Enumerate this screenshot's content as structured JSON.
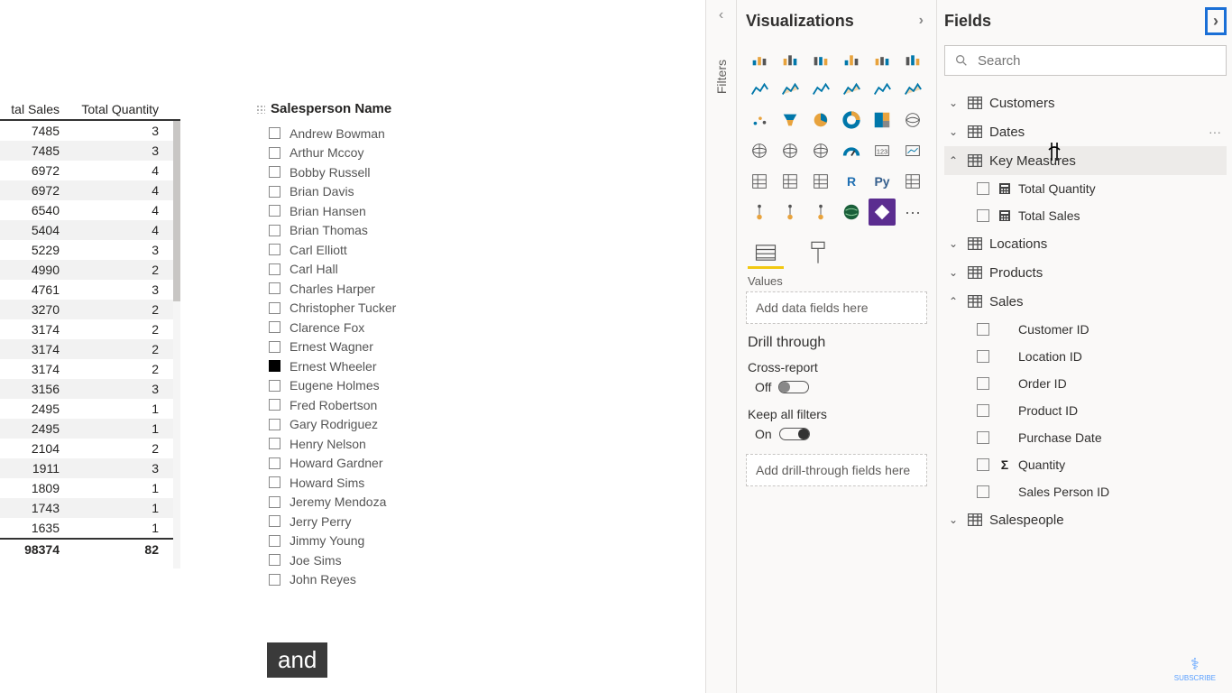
{
  "panes": {
    "visualizations_title": "Visualizations",
    "fields_title": "Fields",
    "filters_title": "Filters"
  },
  "search": {
    "placeholder": "Search"
  },
  "table": {
    "headers": {
      "sales": "tal Sales",
      "qty": "Total Quantity"
    },
    "rows": [
      {
        "sales": "7485",
        "qty": "3"
      },
      {
        "sales": "7485",
        "qty": "3"
      },
      {
        "sales": "6972",
        "qty": "4"
      },
      {
        "sales": "6972",
        "qty": "4"
      },
      {
        "sales": "6540",
        "qty": "4"
      },
      {
        "sales": "5404",
        "qty": "4"
      },
      {
        "sales": "5229",
        "qty": "3"
      },
      {
        "sales": "4990",
        "qty": "2"
      },
      {
        "sales": "4761",
        "qty": "3"
      },
      {
        "sales": "3270",
        "qty": "2"
      },
      {
        "sales": "3174",
        "qty": "2"
      },
      {
        "sales": "3174",
        "qty": "2"
      },
      {
        "sales": "3174",
        "qty": "2"
      },
      {
        "sales": "3156",
        "qty": "3"
      },
      {
        "sales": "2495",
        "qty": "1"
      },
      {
        "sales": "2495",
        "qty": "1"
      },
      {
        "sales": "2104",
        "qty": "2"
      },
      {
        "sales": "1911",
        "qty": "3"
      },
      {
        "sales": "1809",
        "qty": "1"
      },
      {
        "sales": "1743",
        "qty": "1"
      },
      {
        "sales": "1635",
        "qty": "1"
      }
    ],
    "total": {
      "sales": "98374",
      "qty": "82"
    }
  },
  "slicer": {
    "title": "Salesperson Name",
    "items": [
      {
        "name": "Andrew Bowman",
        "checked": false
      },
      {
        "name": "Arthur Mccoy",
        "checked": false
      },
      {
        "name": "Bobby Russell",
        "checked": false
      },
      {
        "name": "Brian Davis",
        "checked": false
      },
      {
        "name": "Brian Hansen",
        "checked": false
      },
      {
        "name": "Brian Thomas",
        "checked": false
      },
      {
        "name": "Carl Elliott",
        "checked": false
      },
      {
        "name": "Carl Hall",
        "checked": false
      },
      {
        "name": "Charles Harper",
        "checked": false
      },
      {
        "name": "Christopher Tucker",
        "checked": false
      },
      {
        "name": "Clarence Fox",
        "checked": false
      },
      {
        "name": "Ernest Wagner",
        "checked": false
      },
      {
        "name": "Ernest Wheeler",
        "checked": true
      },
      {
        "name": "Eugene Holmes",
        "checked": false
      },
      {
        "name": "Fred Robertson",
        "checked": false
      },
      {
        "name": "Gary Rodriguez",
        "checked": false
      },
      {
        "name": "Henry Nelson",
        "checked": false
      },
      {
        "name": "Howard Gardner",
        "checked": false
      },
      {
        "name": "Howard Sims",
        "checked": false
      },
      {
        "name": "Jeremy Mendoza",
        "checked": false
      },
      {
        "name": "Jerry Perry",
        "checked": false
      },
      {
        "name": "Jimmy Young",
        "checked": false
      },
      {
        "name": "Joe Sims",
        "checked": false
      },
      {
        "name": "John Reyes",
        "checked": false
      }
    ]
  },
  "viz": {
    "values_label": "Values",
    "values_placeholder": "Add data fields here",
    "drill_header": "Drill through",
    "cross_report_label": "Cross-report",
    "cross_report_state": "Off",
    "keep_filters_label": "Keep all filters",
    "keep_filters_state": "On",
    "drill_placeholder": "Add drill-through fields here",
    "icons": {
      "r": "R",
      "py": "Py"
    }
  },
  "fields": {
    "tables": [
      {
        "name": "Customers",
        "expanded": false,
        "children": []
      },
      {
        "name": "Dates",
        "expanded": false,
        "hover": true,
        "children": []
      },
      {
        "name": "Key Measures",
        "expanded": true,
        "selected": true,
        "children": [
          {
            "name": "Total Quantity",
            "icon": "calc"
          },
          {
            "name": "Total Sales",
            "icon": "calc"
          }
        ]
      },
      {
        "name": "Locations",
        "expanded": false,
        "children": []
      },
      {
        "name": "Products",
        "expanded": false,
        "children": []
      },
      {
        "name": "Sales",
        "expanded": true,
        "children": [
          {
            "name": "Customer ID",
            "icon": ""
          },
          {
            "name": "Location ID",
            "icon": ""
          },
          {
            "name": "Order ID",
            "icon": ""
          },
          {
            "name": "Product ID",
            "icon": ""
          },
          {
            "name": "Purchase Date",
            "icon": ""
          },
          {
            "name": "Quantity",
            "icon": "sigma"
          },
          {
            "name": "Sales Person ID",
            "icon": ""
          }
        ]
      },
      {
        "name": "Salespeople",
        "expanded": false,
        "children": []
      }
    ]
  },
  "caption": "and",
  "subscribe_label": "SUBSCRIBE"
}
